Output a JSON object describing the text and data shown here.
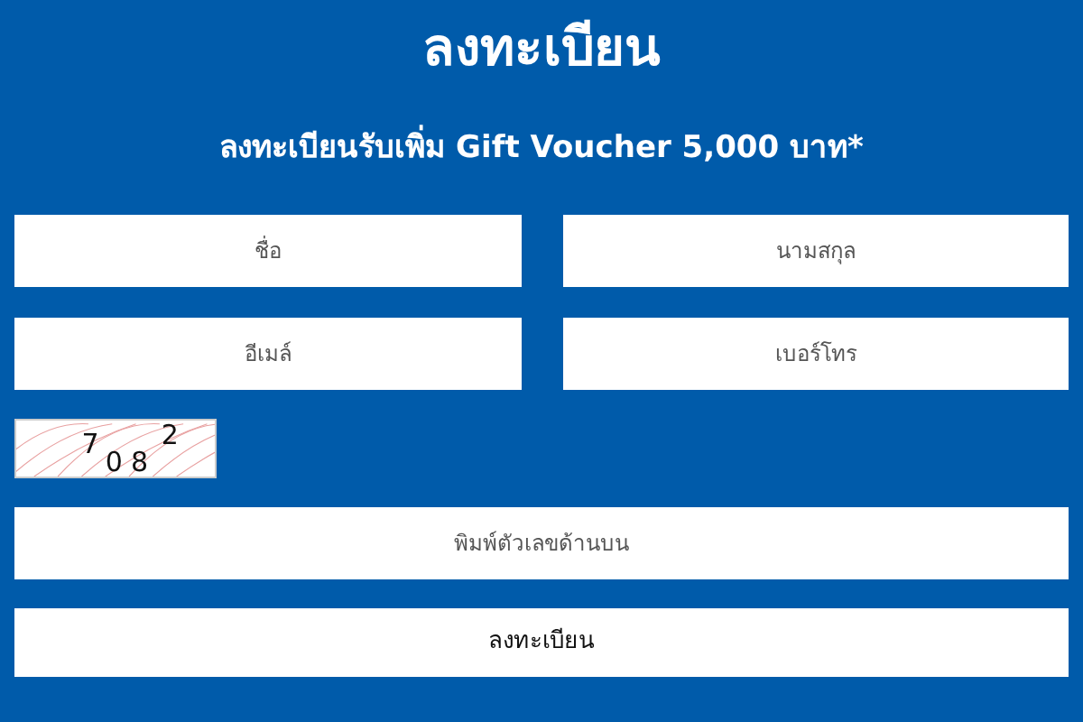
{
  "title": "ลงทะเบียน",
  "subtitle": "ลงทะเบียนรับเพิ่ม Gift Voucher 5,000 บาท*",
  "fields": [
    {
      "placeholder": "ชื่อ"
    },
    {
      "placeholder": "นามสกุล"
    },
    {
      "placeholder": "อีเมล์"
    },
    {
      "placeholder": "เบอร์โทร"
    }
  ],
  "captcha": {
    "code": "7082"
  },
  "captcha_field": {
    "placeholder": "พิมพ์ตัวเลขด้านบน"
  },
  "submit_button": "ลงทะเบียน"
}
